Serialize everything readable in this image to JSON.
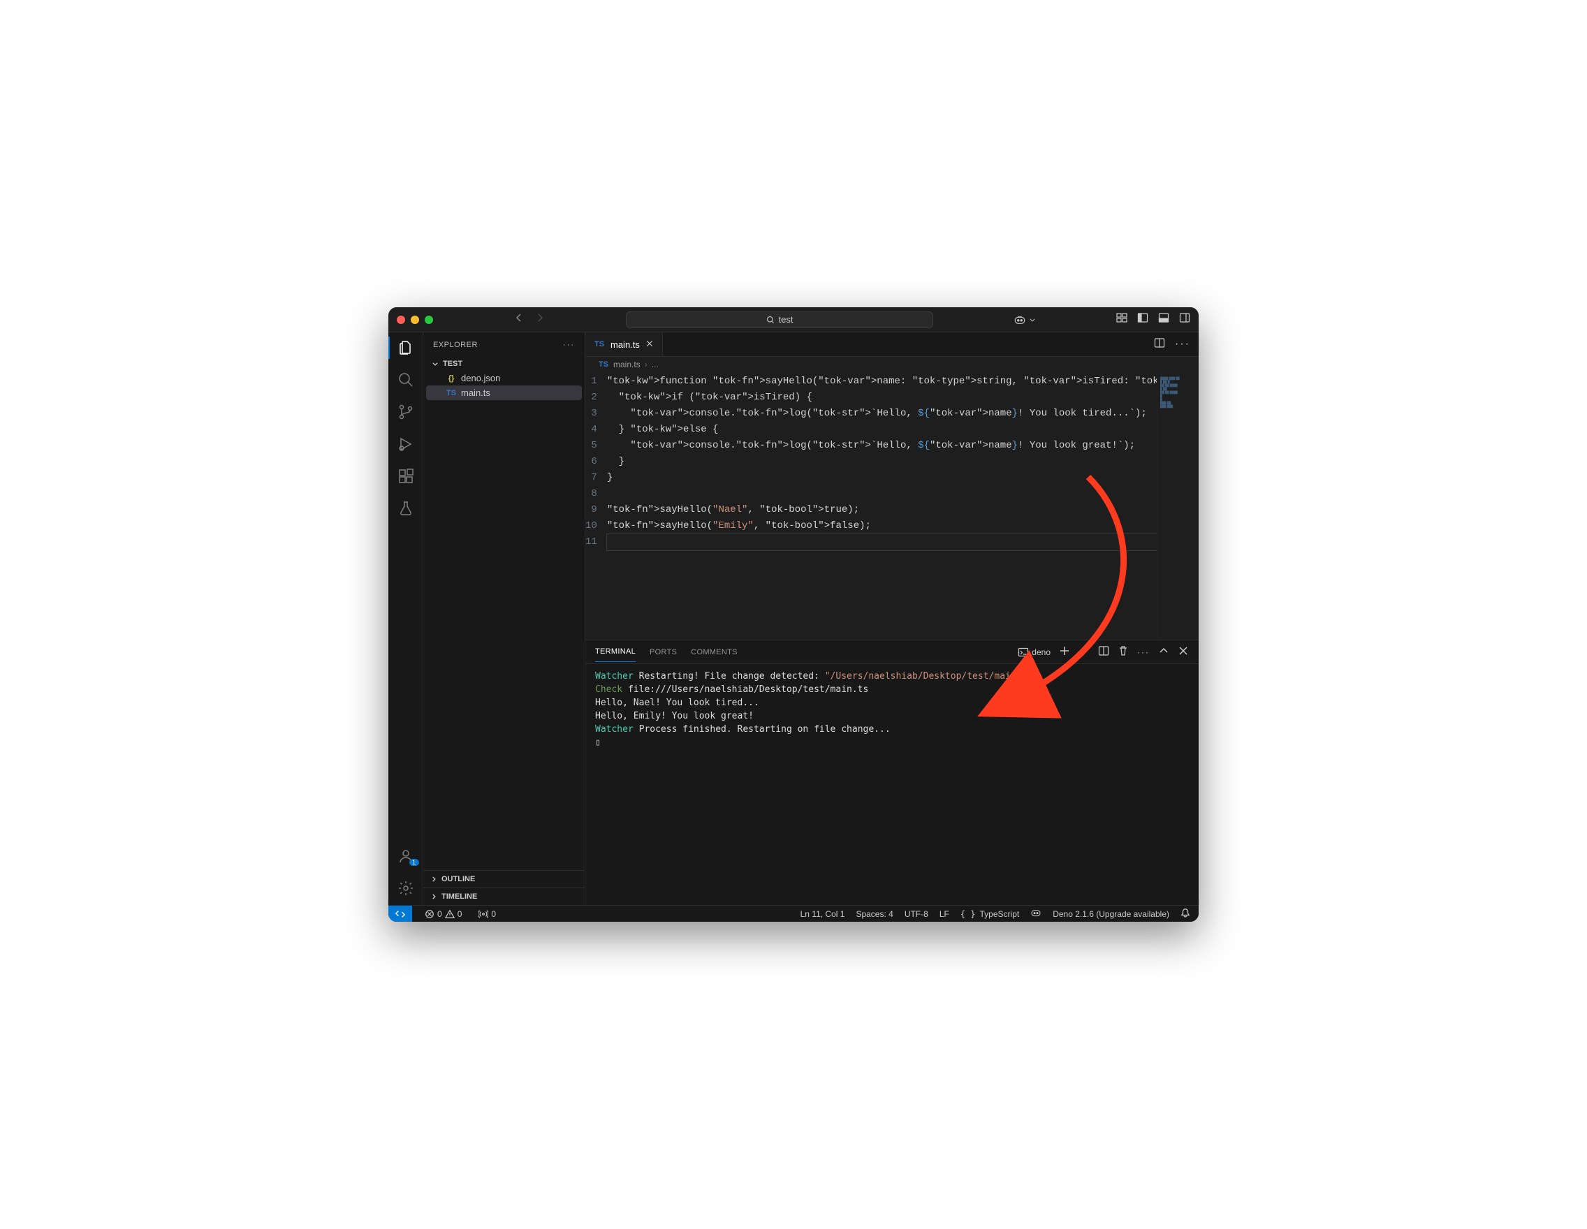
{
  "titlebar": {
    "search_text": "test",
    "copilot_label": ""
  },
  "sidebar": {
    "title": "EXPLORER",
    "root": "TEST",
    "files": [
      {
        "icon": "{}",
        "iconClass": "json",
        "name": "deno.json",
        "selected": false
      },
      {
        "icon": "TS",
        "iconClass": "ts",
        "name": "main.ts",
        "selected": true
      }
    ],
    "sections": [
      "OUTLINE",
      "TIMELINE"
    ],
    "account_badge": "1"
  },
  "editor": {
    "tab_icon": "TS",
    "tab_name": "main.ts",
    "breadcrumb_file": "main.ts",
    "breadcrumb_more": "...",
    "lines": [
      "function sayHello(name: string, isTired: boolean) {",
      "  if (isTired) {",
      "    console.log(`Hello, ${name}! You look tired...`);",
      "  } else {",
      "    console.log(`Hello, ${name}! You look great!`);",
      "  }",
      "}",
      "",
      "sayHello(\"Nael\", true);",
      "sayHello(\"Emily\", false);",
      ""
    ],
    "line_numbers": [
      "1",
      "2",
      "3",
      "4",
      "5",
      "6",
      "7",
      "8",
      "9",
      "10",
      "11"
    ]
  },
  "panel": {
    "tabs": [
      "TERMINAL",
      "PORTS",
      "COMMENTS"
    ],
    "active_tab": 0,
    "shell_name": "deno",
    "output": [
      {
        "prefix": "Watcher",
        "prefixClass": "t-watch",
        "rest": " Restarting! File change detected: ",
        "path": "\"/Users/naelshiab/Desktop/test/main.ts\""
      },
      {
        "prefix": "Check",
        "prefixClass": "t-check",
        "rest": " file:///Users/naelshiab/Desktop/test/main.ts"
      },
      {
        "plain": "Hello, Nael! You look tired..."
      },
      {
        "plain": "Hello, Emily! You look great!"
      },
      {
        "prefix": "Watcher",
        "prefixClass": "t-watch",
        "rest": " Process finished. Restarting on file change..."
      },
      {
        "plain": "▯"
      }
    ]
  },
  "status": {
    "errors": "0",
    "warnings": "0",
    "ports": "0",
    "cursor": "Ln 11, Col 1",
    "spaces": "Spaces: 4",
    "encoding": "UTF-8",
    "eol": "LF",
    "language": "TypeScript",
    "deno": "Deno 2.1.6 (Upgrade available)"
  }
}
